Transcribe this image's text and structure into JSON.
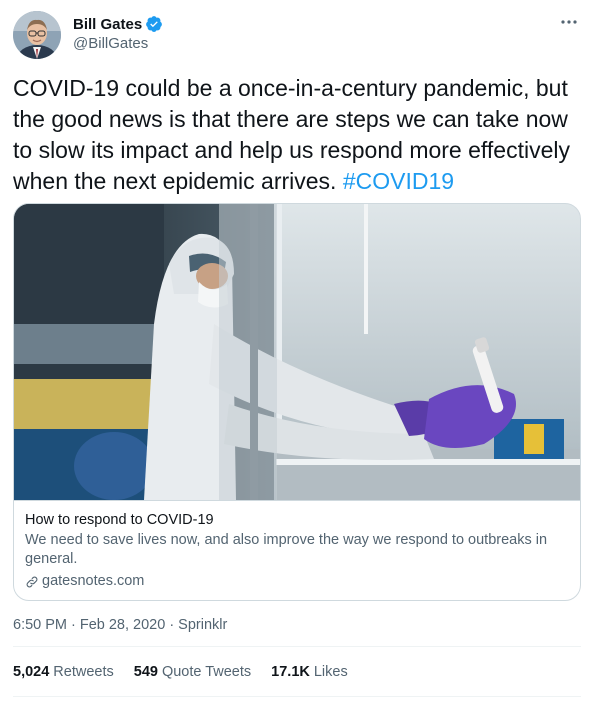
{
  "author": {
    "display_name": "Bill Gates",
    "handle": "@BillGates",
    "verified": true
  },
  "tweet": {
    "text": "COVID-19 could be a once-in-a-century pandemic, but the good news is that there are steps we can take now to slow its impact and help us respond more effectively when the next epidemic arrives. ",
    "hashtag": "#COVID19"
  },
  "card": {
    "title": "How to respond to COVID-19",
    "description": "We need to save lives now, and also improve the way we respond to outbreaks in general.",
    "domain": "gatesnotes.com"
  },
  "meta": {
    "time": "6:50 PM",
    "date": "Feb 28, 2020",
    "source": "Sprinklr",
    "separator": "·"
  },
  "stats": {
    "retweets_count": "5,024",
    "retweets_label": "Retweets",
    "quotes_count": "549",
    "quotes_label": "Quote Tweets",
    "likes_count": "17.1K",
    "likes_label": "Likes"
  },
  "colors": {
    "accent": "#1d9bf0",
    "text_primary": "#0f1419",
    "text_secondary": "#536471",
    "border": "#cfd9de"
  }
}
